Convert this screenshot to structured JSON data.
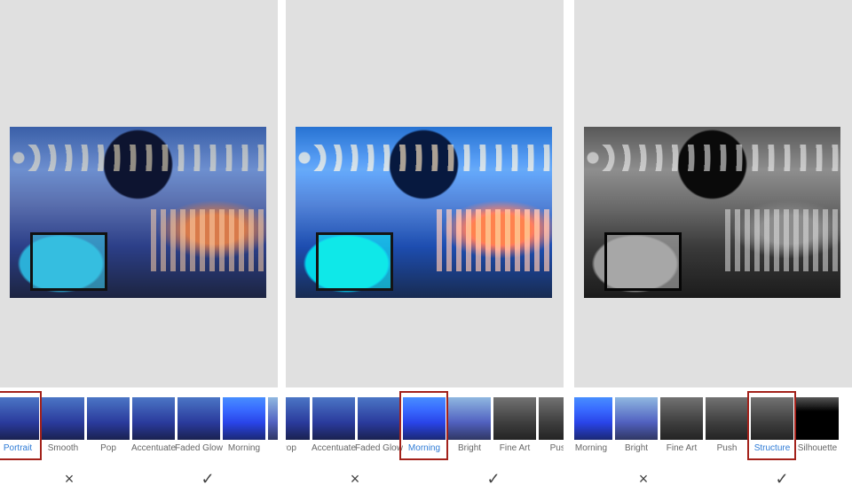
{
  "filters": [
    "Portrait",
    "Smooth",
    "Pop",
    "Accentuate",
    "Faded Glow",
    "Morning",
    "Bright",
    "Fine Art",
    "Push",
    "Structure",
    "Silhouette"
  ],
  "panels": [
    {
      "selected": "Portrait"
    },
    {
      "selected": "Morning"
    },
    {
      "selected": "Structure"
    }
  ],
  "actions": {
    "cancel_icon": "×",
    "apply_icon": "✓"
  },
  "colors": {
    "selected_label": "#2e7bd6",
    "selection_border": "#a3221b",
    "viewer_bg": "#e0e0e0"
  }
}
